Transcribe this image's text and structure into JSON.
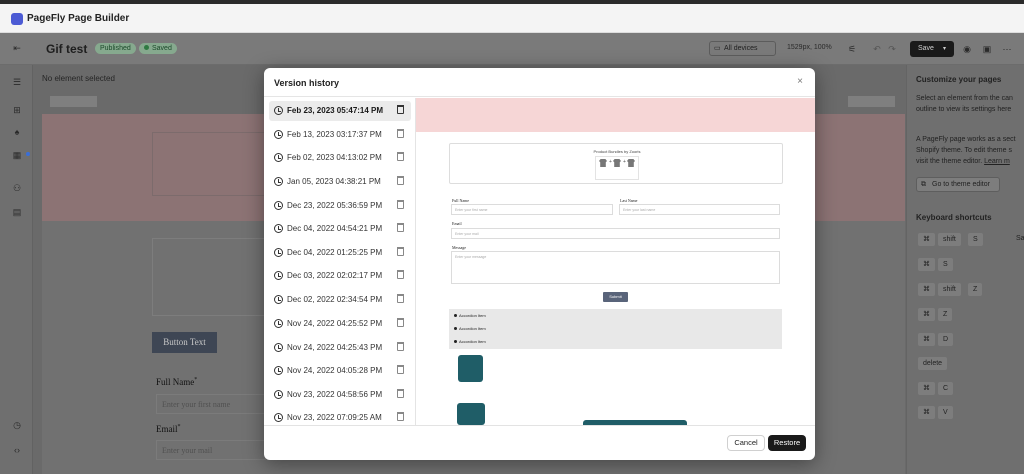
{
  "app": {
    "title": "PageFly Page Builder"
  },
  "toolbar": {
    "page_name": "Gif test",
    "published_badge": "Published",
    "saved_badge": "Saved",
    "devices_label": "All devices",
    "viewport_info": "1529px, 100%",
    "save_label": "Save"
  },
  "editor": {
    "no_element": "No element selected",
    "canvas": {
      "button_text": "Button Text",
      "full_name_label": "Full Name",
      "full_name_placeholder": "Enter your first name",
      "email_label": "Email",
      "email_placeholder": "Enter your mail",
      "required_mark": "*"
    }
  },
  "right_panel": {
    "heading": "Customize your pages",
    "line1": "Select an element from the can",
    "line2": "outline to view its settings here",
    "line3": "A PageFly page works as a sect",
    "line4": "Shopify theme. To edit theme s",
    "line5_prefix": "visit the theme editor. ",
    "line5_link": "Learn m",
    "theme_button": "Go to theme editor",
    "shortcuts_heading": "Keyboard shortcuts",
    "shortcuts": [
      {
        "keys": [
          "⌘",
          "shift",
          "S"
        ],
        "action": "Sa"
      },
      {
        "keys": [
          "⌘",
          "S"
        ]
      },
      {
        "keys": [
          "⌘",
          "shift",
          "Z"
        ]
      },
      {
        "keys": [
          "⌘",
          "Z"
        ]
      },
      {
        "keys": [
          "⌘",
          "D"
        ]
      },
      {
        "keys": [
          "delete"
        ]
      },
      {
        "keys": [
          "⌘",
          "C"
        ]
      },
      {
        "keys": [
          "⌘",
          "V"
        ]
      }
    ]
  },
  "modal": {
    "title": "Version history",
    "close_glyph": "×",
    "versions": [
      "Feb 23, 2023 05:47:14 PM",
      "Feb 13, 2023 03:17:37 PM",
      "Feb 02, 2023 04:13:02 PM",
      "Jan 05, 2023 04:38:21 PM",
      "Dec 23, 2022 05:36:59 PM",
      "Dec 04, 2022 04:54:21 PM",
      "Dec 04, 2022 01:25:25 PM",
      "Dec 03, 2022 02:02:17 PM",
      "Dec 02, 2022 02:34:54 PM",
      "Nov 24, 2022 04:25:52 PM",
      "Nov 24, 2022 04:25:43 PM",
      "Nov 24, 2022 04:05:28 PM",
      "Nov 23, 2022 04:58:56 PM",
      "Nov 23, 2022 07:09:25 AM"
    ],
    "preview": {
      "product_title": "Product Bundles by Zooris",
      "full_name": "Full Name",
      "full_name_placeholder": "Enter your first name",
      "last_name": "Last Name",
      "last_name_placeholder": "Enter your last name",
      "email": "Email",
      "email_placeholder": "Enter your mail",
      "message": "Message",
      "message_placeholder": "Enter your message",
      "submit": "Submit",
      "accordion_items": [
        "Accordion Item",
        "Accordion Item",
        "Accordion Item"
      ]
    },
    "cancel_label": "Cancel",
    "restore_label": "Restore"
  },
  "colors": {
    "brand": "#4c5bd4",
    "primary_button": "#1a1a1a",
    "preview_pink": "#f6d6d6",
    "preview_submit": "#59647a"
  }
}
